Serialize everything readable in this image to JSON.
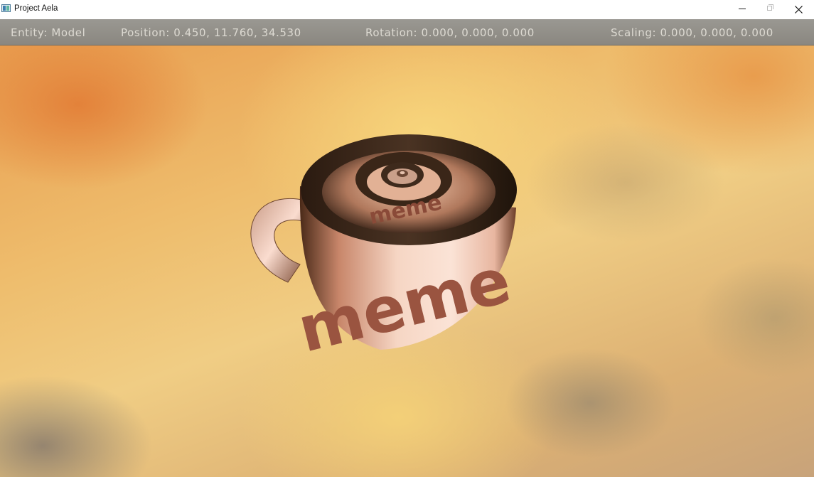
{
  "window": {
    "title": "Project Aela",
    "icon": "app-icon",
    "controls": [
      "minimize",
      "restore",
      "close"
    ]
  },
  "hud": {
    "entity": "Entity: Model",
    "position": "Position: 0.450, 11.760, 34.530",
    "rotation": "Rotation: 0.000, 0.000, 0.000",
    "scaling": "Scaling: 0.000, 0.000, 0.000"
  },
  "scene": {
    "mug_text": "meme",
    "inner_mug_text": "meme"
  }
}
